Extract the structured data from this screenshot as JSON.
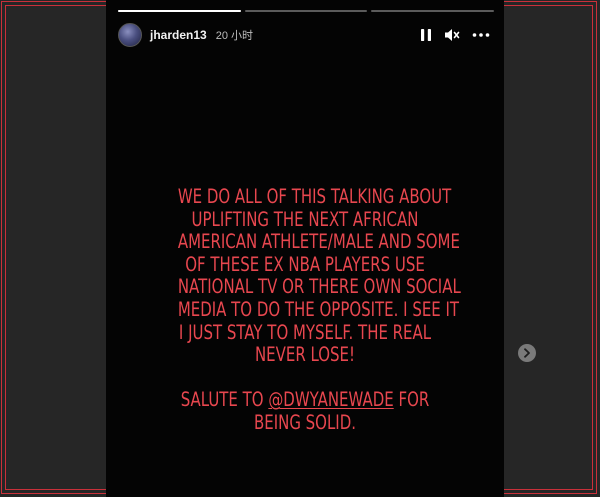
{
  "story": {
    "username": "jharden13",
    "time_ago": "20 小时",
    "progress": [
      1,
      0,
      0
    ],
    "text_lines": [
      "WE DO ALL OF THIS TALKING ABOUT",
      "UPLIFTING THE NEXT AFRICAN",
      "AMERICAN ATHLETE/MALE AND SOME",
      "OF THESE EX NBA PLAYERS USE",
      "NATIONAL TV OR THERE OWN SOCIAL",
      "MEDIA TO DO THE OPPOSITE. I SEE IT",
      "I JUST STAY TO MYSELF. THE REAL",
      "NEVER LOSE!",
      "",
      "SALUTE TO",
      "@DWYANEWADE",
      "FOR",
      "BEING SOLID."
    ]
  },
  "colors": {
    "text_accent": "#e8474f",
    "frame": "#c9303a",
    "story_bg": "#040404"
  },
  "icons": {
    "pause": "pause-icon",
    "mute": "volume-muted-icon",
    "more": "more-icon",
    "next": "chevron-right-icon"
  }
}
